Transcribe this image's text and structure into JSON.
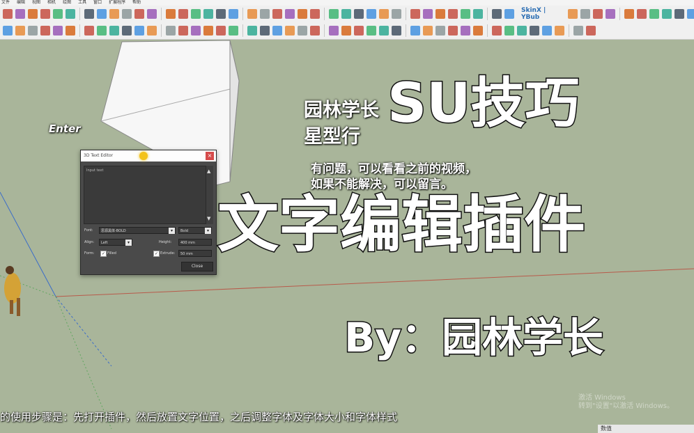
{
  "app": {
    "menubar": [
      "文件",
      "编辑",
      "视图",
      "相机",
      "绘图",
      "工具",
      "窗口",
      "扩展程序",
      "帮助"
    ],
    "skin_label": "SkinX | YBub"
  },
  "colors": {
    "viewport_bg": "#a9b59a",
    "toolbar_bg": "#f0f0f0",
    "dialog_bg": "#4a4a4a",
    "close_red": "#d64b4b"
  },
  "toolbar_icons": [
    "select-icon",
    "eraser-icon",
    "paint-icon",
    "line-icon",
    "arc-icon",
    "rectangle-icon",
    "pushpull-icon",
    "move-icon",
    "rotate-icon",
    "scale-icon",
    "offset-icon",
    "tape-icon",
    "text-icon",
    "axes-icon",
    "orbit-icon",
    "pan-icon",
    "zoom-icon",
    "sandbox-icon",
    "plugin-icon",
    "help-icon"
  ],
  "viewport": {
    "enter_label": "Enter",
    "scene_text_line1": "园林学长",
    "scene_text_line2": "星型行",
    "scene_text_line3": "有问题，可以看看之前的视频，",
    "scene_text_line4": "如果不能解决，可以留言。"
  },
  "overlay": {
    "title": "SU技巧",
    "main": "文字编辑插件",
    "author": "By：园林学长"
  },
  "dialog": {
    "title": "3D Text Editor",
    "close": "×",
    "text_placeholder": "Input text",
    "font_label": "Font:",
    "font_value": "思源黑体-BOLD",
    "style_value": "Bold",
    "align_label": "Align:",
    "align_value": "Left",
    "height_label": "Height:",
    "height_value": "400 mm",
    "form_label": "Form:",
    "filled_label": "Filled",
    "extrude_label": "Extrude:",
    "extrude_value": "50 mm",
    "button": "Close"
  },
  "subtitle": "的使用步骤是：先打开插件，然后放置文字位置，之后调整字体及字体大小和字体样式",
  "windows_watermark_line1": "激活 Windows",
  "windows_watermark_line2": "转到\"设置\"以激活 Windows。",
  "status_corner": "数值"
}
